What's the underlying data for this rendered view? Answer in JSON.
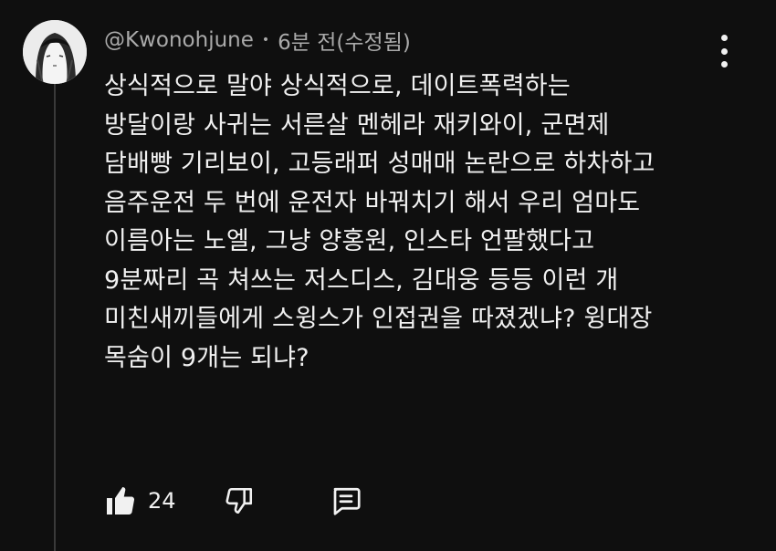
{
  "comment": {
    "author": "@Kwonohjune",
    "separator": "•",
    "timestamp": "6분 전(수정됨)",
    "lines": [
      "상식적으로 말야 상식적으로, 데이트폭력하는",
      "방달이랑 사귀는 서른살 멘헤라 재키와이, 군면제",
      "담배빵 기리보이, 고등래퍼 성매매 논란으로 하차하고",
      "음주운전 두 번에 운전자 바꿔치기 해서 우리 엄마도",
      "이름아는 노엘, 그냥 양홍원, 인스타 언팔했다고",
      "9분짜리 곡 쳐쓰는 저스디스, 김대웅 등등 이런 개",
      "미친새끼들에게 스윙스가 인접권을 따졌겠냐? 윙대장",
      "목숨이 9개는 되냐?"
    ],
    "like_count": "24"
  },
  "icons": {
    "avatar": "avatar",
    "menu": "more-vertical-icon",
    "like": "thumbs-up-icon",
    "dislike": "thumbs-down-icon",
    "reply": "comment-reply-icon"
  },
  "colors": {
    "background": "#0f0f0f",
    "text": "#f1f1f1",
    "meta_text": "#aaaaaa",
    "thread_line": "#3a3a3a"
  }
}
